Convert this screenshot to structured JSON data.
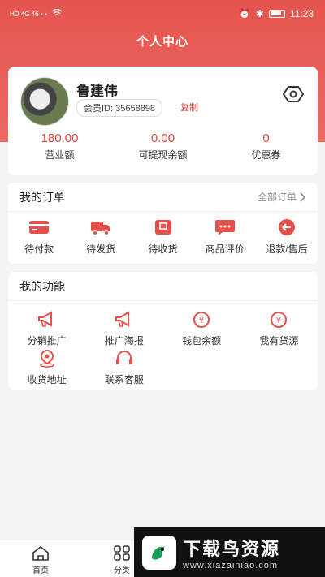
{
  "statusbar": {
    "left_indicators": "HD 4G 46 ▪ ▪",
    "time": "11:23"
  },
  "page_title": "个人中心",
  "profile": {
    "name": "鲁建伟",
    "member_id": "会员ID: 35658898",
    "copy_label": "复制"
  },
  "stats": [
    {
      "value": "180.00",
      "label": "营业额"
    },
    {
      "value": "0.00",
      "label": "可提现余额"
    },
    {
      "value": "0",
      "label": "优惠券"
    }
  ],
  "orders": {
    "title": "我的订单",
    "all_label": "全部订单",
    "items": [
      {
        "label": "待付款",
        "icon": "card-icon"
      },
      {
        "label": "待发货",
        "icon": "truck-icon"
      },
      {
        "label": "待收货",
        "icon": "package-icon"
      },
      {
        "label": "商品评价",
        "icon": "comment-icon"
      },
      {
        "label": "退款/售后",
        "icon": "return-icon"
      }
    ]
  },
  "functions": {
    "title": "我的功能",
    "items": [
      {
        "label": "分销推广",
        "icon": "megaphone-icon"
      },
      {
        "label": "推广海报",
        "icon": "megaphone-icon"
      },
      {
        "label": "钱包余额",
        "icon": "yen-icon"
      },
      {
        "label": "我有货源",
        "icon": "yen-icon"
      },
      {
        "label": "收货地址",
        "icon": "location-icon"
      },
      {
        "label": "联系客服",
        "icon": "headset-icon"
      }
    ]
  },
  "tabbar": {
    "home": "首页",
    "category": "分类"
  },
  "watermark": {
    "title": "下载鸟资源",
    "url": "www.xiazainiao.com"
  },
  "colors": {
    "accent": "#d9463f",
    "header": "#e5544f"
  }
}
